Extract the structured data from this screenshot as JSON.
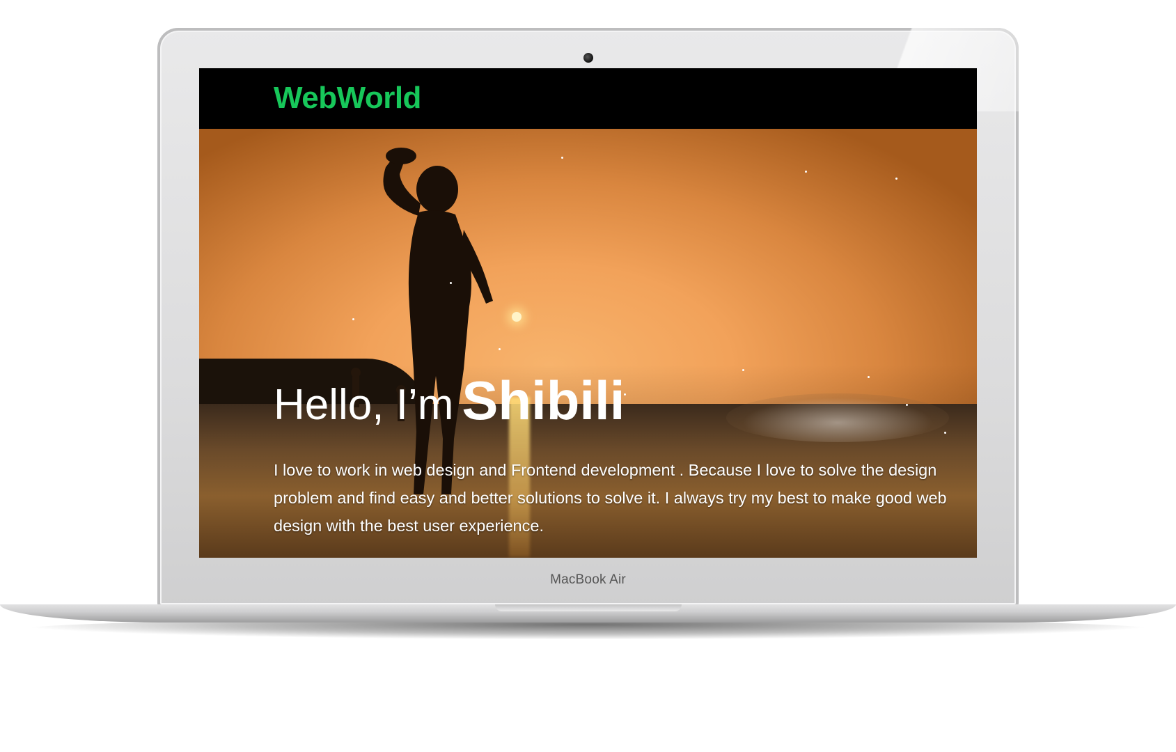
{
  "device": {
    "model_label": "MacBook Air"
  },
  "site": {
    "logo": "WebWorld",
    "logo_color": "#17c75a"
  },
  "hero": {
    "greeting": "Hello, I’m",
    "name": "Shibili",
    "description": "I love to work in web design and Frontend development . Because I love to solve the design problem and find easy and better solutions to solve it. I always try my best to make good web design with the best user experience."
  }
}
